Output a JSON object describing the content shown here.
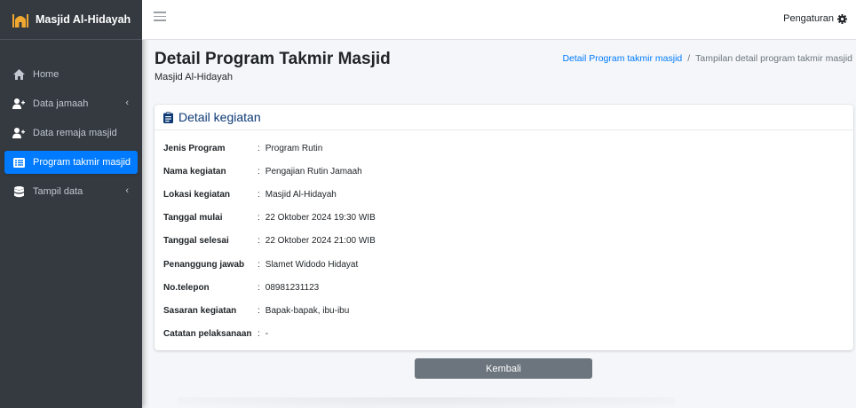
{
  "brand": {
    "name": "Masjid Al-Hidayah"
  },
  "sidebar": {
    "items": [
      {
        "label": "Home"
      },
      {
        "label": "Data jamaah"
      },
      {
        "label": "Data remaja masjid"
      },
      {
        "label": "Program takmir masjid"
      },
      {
        "label": "Tampil data"
      }
    ]
  },
  "topbar": {
    "settings_label": "Pengaturan"
  },
  "header": {
    "title": "Detail Program Takmir Masjid",
    "subtitle": "Masjid Al-Hidayah",
    "breadcrumb_link": "Detail Program takmir masjid",
    "breadcrumb_sep": "/",
    "breadcrumb_current": "Tampilan detail program takmir masjid"
  },
  "card": {
    "title": "Detail kegiatan",
    "rows": [
      {
        "label": "Jenis Program",
        "value": "Program Rutin"
      },
      {
        "label": "Nama kegiatan",
        "value": "Pengajian Rutin Jamaah"
      },
      {
        "label": "Lokasi kegiatan",
        "value": "Masjid Al-Hidayah"
      },
      {
        "label": "Tanggal mulai",
        "value": "22 Oktober 2024 19:30 WIB"
      },
      {
        "label": "Tanggal selesai",
        "value": "22 Oktober 2024 21:00 WIB"
      },
      {
        "label": "Penanggung jawab",
        "value": "Slamet Widodo Hidayat"
      },
      {
        "label": "No.telepon",
        "value": "08981231123"
      },
      {
        "label": "Sasaran kegiatan",
        "value": "Bapak-bapak, ibu-ibu"
      },
      {
        "label": "Catatan pelaksanaan",
        "value": "-"
      }
    ],
    "colon": ":"
  },
  "actions": {
    "back_label": "Kembali"
  },
  "colors": {
    "sidebar": "#343a40",
    "active": "#007bff",
    "button": "#6c757d",
    "card_title": "#0d3a75"
  }
}
